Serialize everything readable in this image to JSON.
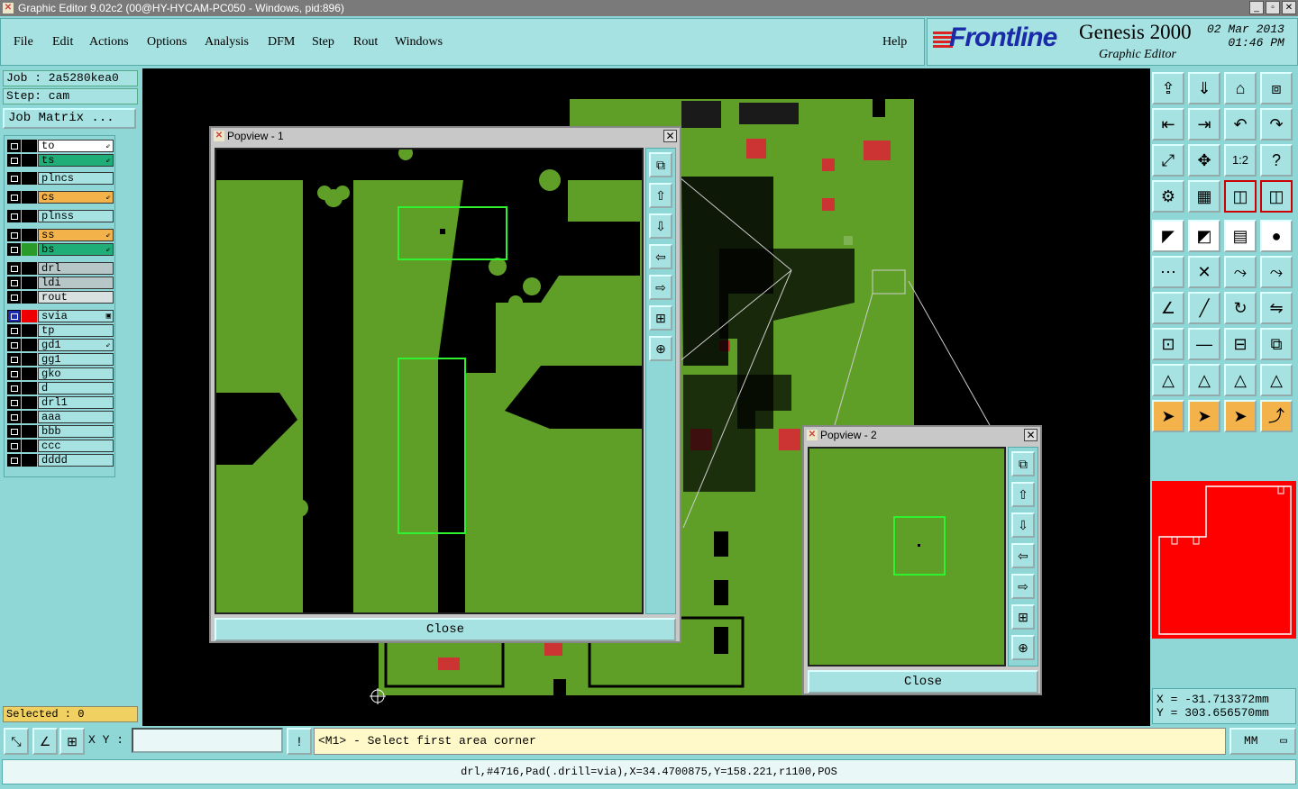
{
  "window": {
    "title": "Graphic Editor 9.02c2 (00@HY-HYCAM-PC050 - Windows, pid:896)"
  },
  "menu": {
    "file": "File",
    "edit": "Edit",
    "actions": "Actions",
    "options": "Options",
    "analysis": "Analysis",
    "dfm": "DFM",
    "step": "Step",
    "rout": "Rout",
    "windows": "Windows",
    "help": "Help"
  },
  "brand": {
    "logo": "Frontline",
    "product": "Genesis 2000",
    "subtitle": "Graphic Editor",
    "date": "02 Mar 2013",
    "time": "01:46 PM"
  },
  "job": {
    "job_line": "Job : 2a5280kea0",
    "step_line": "Step: cam",
    "matrix_button": "Job Matrix ..."
  },
  "layers": [
    {
      "name": "to",
      "color": "#ffffff",
      "flag": "⇙"
    },
    {
      "name": "ts",
      "color": "#1fae78",
      "flag": "⇙"
    },
    {
      "name": "plncs",
      "color": "#a6e2e2",
      "flag": ""
    },
    {
      "name": "cs",
      "color": "#f3b24a",
      "flag": "⇙"
    },
    {
      "name": "plnss",
      "color": "#a6e2e2",
      "flag": ""
    },
    {
      "name": "ss",
      "color": "#f3b24a",
      "flag": "⇙"
    },
    {
      "name": "bs",
      "color": "#1fae78",
      "flag": "⇙"
    },
    {
      "name": "drl",
      "color": "#b7c7c7",
      "flag": ""
    },
    {
      "name": "ldi",
      "color": "#b7c7c7",
      "flag": ""
    },
    {
      "name": "rout",
      "color": "#d8e0e0",
      "flag": ""
    },
    {
      "name": "svia",
      "color": "#a6e2e2",
      "flag": "▣"
    },
    {
      "name": "tp",
      "color": "#a6e2e2",
      "flag": ""
    },
    {
      "name": "gd1",
      "color": "#a6e2e2",
      "flag": "⇙"
    },
    {
      "name": "gg1",
      "color": "#a6e2e2",
      "flag": ""
    },
    {
      "name": "gko",
      "color": "#a6e2e2",
      "flag": ""
    },
    {
      "name": "d",
      "color": "#a6e2e2",
      "flag": ""
    },
    {
      "name": "drl1",
      "color": "#a6e2e2",
      "flag": ""
    },
    {
      "name": "aaa",
      "color": "#a6e2e2",
      "flag": ""
    },
    {
      "name": "bbb",
      "color": "#a6e2e2",
      "flag": ""
    },
    {
      "name": "ccc",
      "color": "#a6e2e2",
      "flag": ""
    },
    {
      "name": "dddd",
      "color": "#a6e2e2",
      "flag": ""
    }
  ],
  "selected": "Selected : 0",
  "popview1": {
    "title": "Popview - 1",
    "close": "Close"
  },
  "popview2": {
    "title": "Popview - 2",
    "close": "Close"
  },
  "toolbar_icons": [
    "zoom-home-icon",
    "zoom-out-icon",
    "home-icon",
    "window-icon",
    "pan-left-icon",
    "pan-right-icon",
    "undo-icon",
    "redo-icon",
    "fit-icon",
    "center-icon",
    "ratio-icon",
    "help-icon",
    "measure-icon",
    "grid-icon",
    "layers-icon",
    "layers-alt-icon",
    "pad-icon",
    "line-icon",
    "ruler-icon",
    "circle-icon",
    "connect-icon",
    "snap-icon",
    "add-icon",
    "add-alt-icon",
    "angle-icon",
    "slash-icon",
    "arc-icon",
    "flip-icon",
    "move-icon",
    "minus-icon",
    "resize-icon",
    "copy-icon",
    "triangle-icon",
    "triangle-alt-icon",
    "triangle-b-icon",
    "triangle-c-icon",
    "select-icon",
    "select-alt-icon",
    "select-b-icon",
    "route-icon"
  ],
  "toolbar_labels": {
    "ratio": "1:2"
  },
  "coords": {
    "x": "X = -31.713372mm",
    "y": "Y = 303.656570mm"
  },
  "bottom": {
    "xy_label": "X Y :",
    "xy_value": "",
    "prompt": "<M1> - Select first area corner",
    "units": "MM"
  },
  "status": "drl,#4716,Pad(.drill=via),X=34.4700875,Y=158.221,r1100,POS"
}
